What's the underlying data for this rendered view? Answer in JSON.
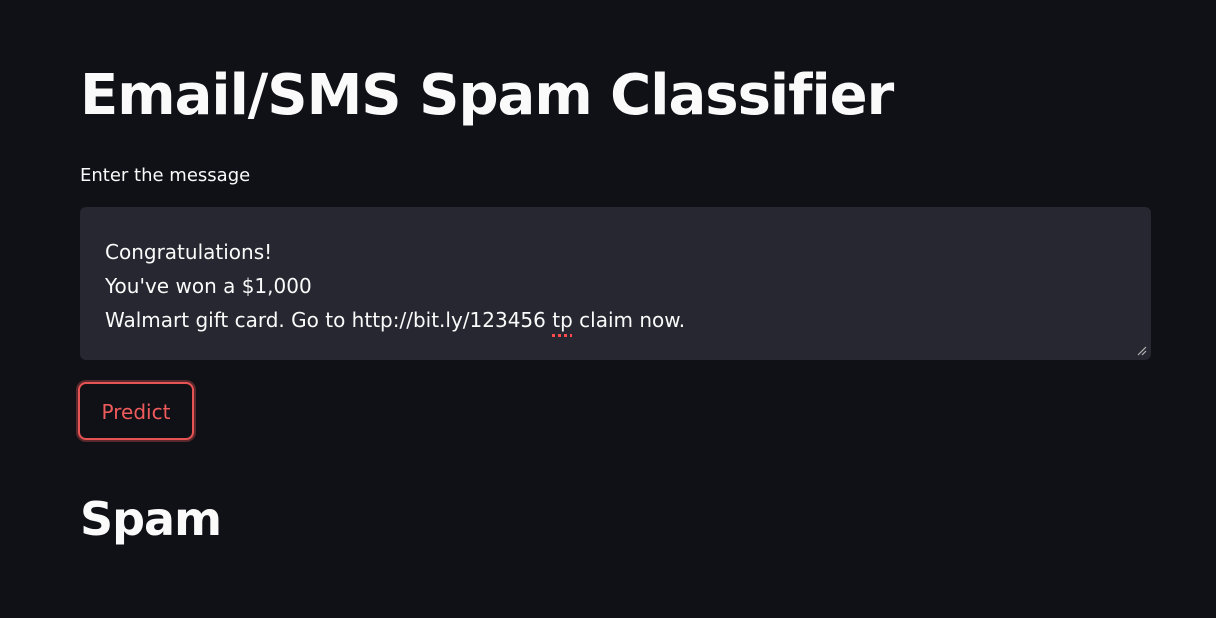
{
  "page": {
    "title": "Email/SMS Spam Classifier"
  },
  "form": {
    "label": "Enter the message",
    "message_before": "Congratulations!\nYou've won a $1,000\nWalmart gift card. Go to http://bit.ly/123456 ",
    "message_flagged": "tp",
    "message_after": " claim now.",
    "button_label": "Predict"
  },
  "result": {
    "text": "Spam"
  },
  "colors": {
    "background": "#101117",
    "textarea": "#262730",
    "accent": "#e65353",
    "text": "#fafafa"
  }
}
